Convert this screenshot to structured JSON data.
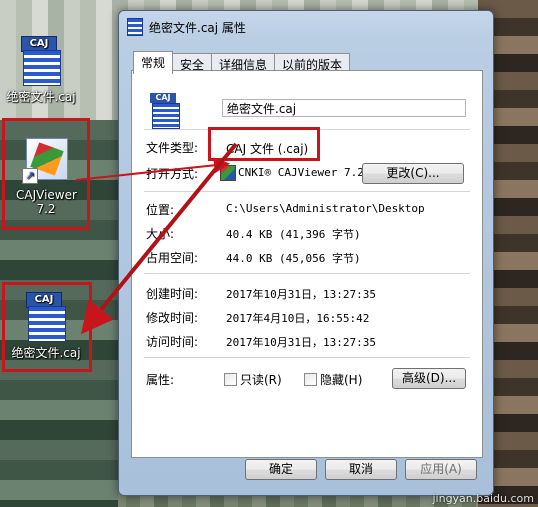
{
  "desktop": {
    "icons": [
      {
        "label": "绝密文件.caj",
        "tag": "CAJ"
      },
      {
        "label": "CAJViewer 7.2"
      },
      {
        "label": "绝密文件.caj",
        "tag": "CAJ"
      }
    ]
  },
  "dialog": {
    "title": "绝密文件.caj 属性",
    "tabs": [
      "常规",
      "安全",
      "详细信息",
      "以前的版本"
    ],
    "file_name": "绝密文件.caj",
    "icon_tag": "CAJ",
    "rows": {
      "type_label": "文件类型:",
      "type_value": "CAJ 文件 (.caj)",
      "open_with_label": "打开方式:",
      "open_with_value": "CNKI® CAJViewer 7.2",
      "change_button": "更改(C)...",
      "location_label": "位置:",
      "location_value": "C:\\Users\\Administrator\\Desktop",
      "size_label": "大小:",
      "size_value": "40.4 KB (41,396 字节)",
      "disk_label": "占用空间:",
      "disk_value": "44.0 KB (45,056 字节)",
      "created_label": "创建时间:",
      "created_value": "2017年10月31日，13:27:35",
      "modified_label": "修改时间:",
      "modified_value": "2017年4月10日，16:55:42",
      "accessed_label": "访问时间:",
      "accessed_value": "2017年10月31日，13:27:35",
      "attr_label": "属性:",
      "readonly_label": "只读(R)",
      "hidden_label": "隐藏(H)",
      "advanced_button": "高级(D)..."
    },
    "buttons": {
      "ok": "确定",
      "cancel": "取消",
      "apply": "应用(A)"
    }
  },
  "watermark": "jingyan.baidu.com",
  "colors": {
    "highlight": "#c8151b",
    "dialog_frame": "#b9cde3"
  }
}
